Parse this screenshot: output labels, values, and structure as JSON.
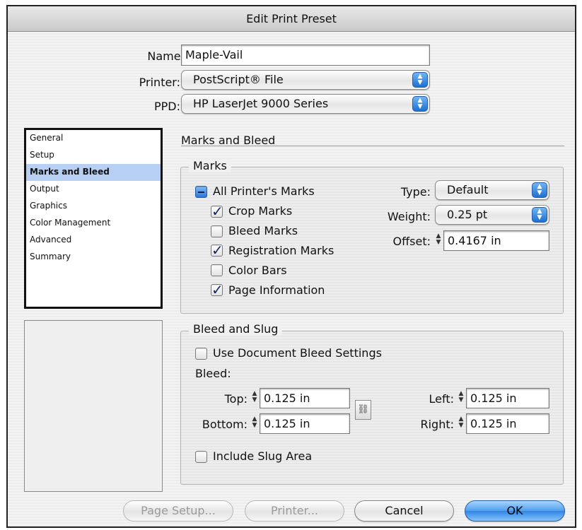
{
  "window": {
    "title": "Edit Print Preset"
  },
  "header": {
    "name_label": "Name:",
    "name_value": "Maple-Vail",
    "printer_label": "Printer:",
    "printer_value": "PostScript® File",
    "ppd_label": "PPD:",
    "ppd_value": "HP LaserJet 9000 Series"
  },
  "sidebar": {
    "items": [
      {
        "label": "General"
      },
      {
        "label": "Setup"
      },
      {
        "label": "Marks and Bleed",
        "selected": true
      },
      {
        "label": "Output"
      },
      {
        "label": "Graphics"
      },
      {
        "label": "Color Management"
      },
      {
        "label": "Advanced"
      },
      {
        "label": "Summary"
      }
    ]
  },
  "panel": {
    "title": "Marks and Bleed"
  },
  "marks": {
    "title": "Marks",
    "all_printers_marks": {
      "label": "All Printer's Marks",
      "state": "mixed"
    },
    "items": [
      {
        "label": "Crop Marks",
        "checked": true
      },
      {
        "label": "Bleed Marks",
        "checked": false
      },
      {
        "label": "Registration Marks",
        "checked": true
      },
      {
        "label": "Color Bars",
        "checked": false
      },
      {
        "label": "Page Information",
        "checked": true
      }
    ],
    "type_label": "Type:",
    "type_value": "Default",
    "weight_label": "Weight:",
    "weight_value": "0.25 pt",
    "offset_label": "Offset:",
    "offset_value": "0.4167 in"
  },
  "bleed": {
    "title": "Bleed and Slug",
    "use_document": {
      "label": "Use Document Bleed Settings",
      "checked": false
    },
    "bleed_label": "Bleed:",
    "top_label": "Top:",
    "top_value": "0.125 in",
    "bottom_label": "Bottom:",
    "bottom_value": "0.125 in",
    "left_label": "Left:",
    "left_value": "0.125 in",
    "right_label": "Right:",
    "right_value": "0.125 in",
    "link_icon": "chain-link-icon",
    "include_slug": {
      "label": "Include Slug Area",
      "checked": false
    }
  },
  "buttons": {
    "page_setup": "Page Setup...",
    "printer": "Printer...",
    "cancel": "Cancel",
    "ok": "OK"
  },
  "colors": {
    "selection": "#b7cff2",
    "default_button": "#4f9fee",
    "popup_arrows": "#1e6fd0"
  }
}
